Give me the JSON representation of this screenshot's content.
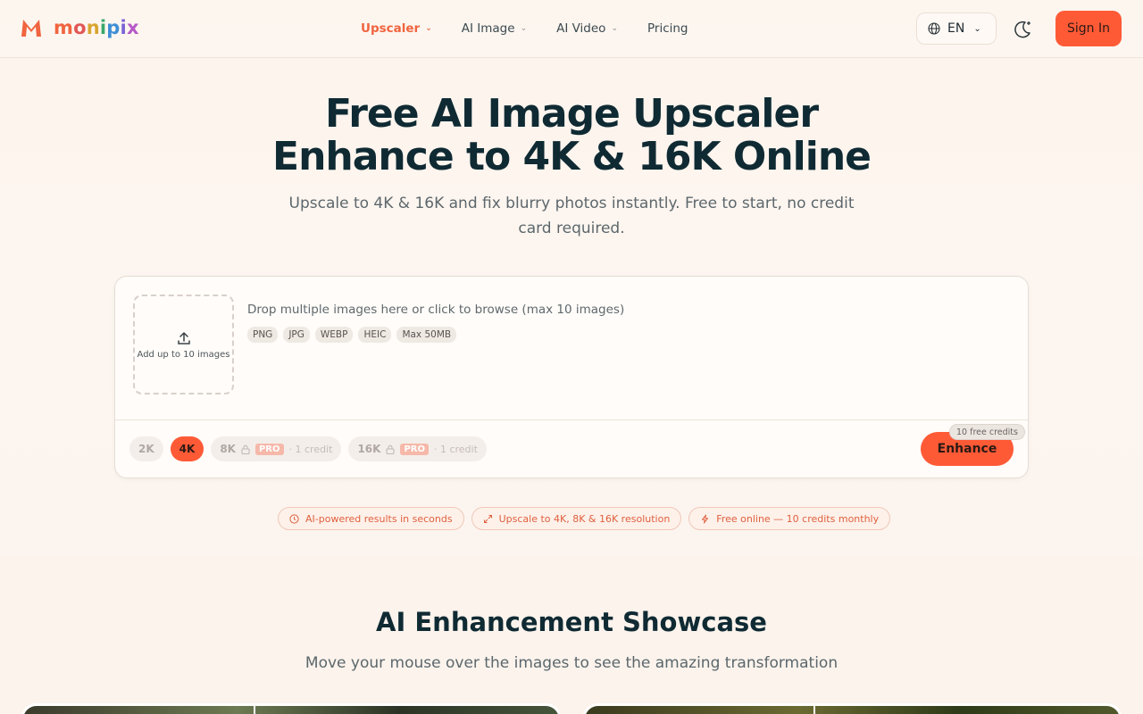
{
  "brand": {
    "name": "monipix",
    "letters": [
      "m",
      "o",
      "n",
      "i",
      "p",
      "i",
      "x"
    ],
    "letter_colors": [
      "#f0643f",
      "#e25757",
      "#d9a531",
      "#39a86b",
      "#3f8ed6",
      "#7a62d6",
      "#b65ac8"
    ],
    "accent": "#ff5a36"
  },
  "nav": {
    "items": [
      {
        "label": "Upscaler",
        "has_dropdown": true,
        "active": true
      },
      {
        "label": "AI Image",
        "has_dropdown": true,
        "active": false
      },
      {
        "label": "AI Video",
        "has_dropdown": true,
        "active": false
      },
      {
        "label": "Pricing",
        "has_dropdown": false,
        "active": false
      }
    ],
    "language": "EN",
    "sign_in": "Sign In"
  },
  "hero": {
    "title_line1": "Free AI Image Upscaler",
    "title_line2": "Enhance to 4K & 16K Online",
    "subtitle": "Upscale to 4K & 16K and fix blurry photos instantly. Free to start, no credit card required."
  },
  "upload": {
    "dropzone_label": "Add up to 10 images",
    "drop_text": "Drop multiple images here or click to browse (max 10 images)",
    "formats": [
      "PNG",
      "JPG",
      "WEBP",
      "HEIC",
      "Max 50MB"
    ],
    "resolutions": [
      {
        "label": "2K",
        "active": false,
        "locked": false
      },
      {
        "label": "4K",
        "active": true,
        "locked": false
      },
      {
        "label": "8K",
        "active": false,
        "locked": true,
        "badge": "PRO",
        "credit": "· 1 credit"
      },
      {
        "label": "16K",
        "active": false,
        "locked": true,
        "badge": "PRO",
        "credit": "· 1 credit"
      }
    ],
    "free_credits_badge": "10 free credits",
    "enhance_label": "Enhance"
  },
  "features": [
    {
      "icon": "clock-icon",
      "label": "AI-powered results in seconds"
    },
    {
      "icon": "expand-icon",
      "label": "Upscale to 4K, 8K & 16K resolution"
    },
    {
      "icon": "bolt-icon",
      "label": "Free online — 10 credits monthly"
    }
  ],
  "showcase": {
    "title": "AI Enhancement Showcase",
    "subtitle": "Move your mouse over the images to see the amazing transformation"
  }
}
